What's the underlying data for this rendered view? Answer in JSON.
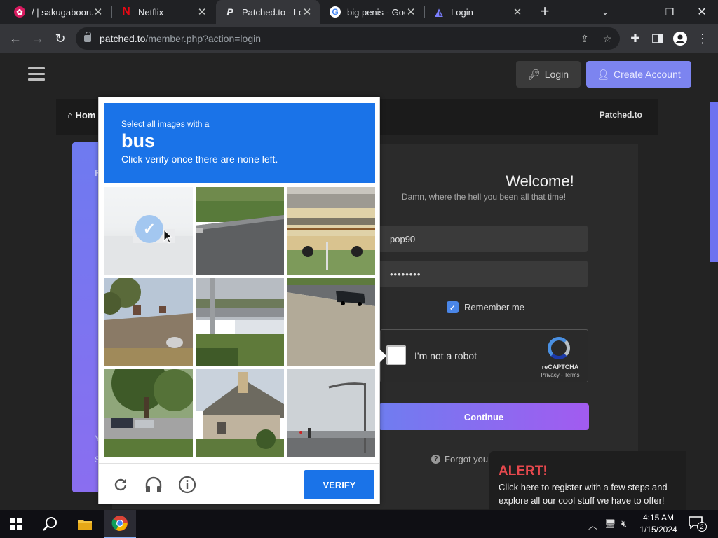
{
  "tabs": [
    {
      "title": "/ | sakugabooru",
      "icon": "sakugabooru-icon"
    },
    {
      "title": "Netflix",
      "icon": "netflix-icon"
    },
    {
      "title": "Patched.to - Log",
      "icon": "patched-icon"
    },
    {
      "title": "big penis - Goo",
      "icon": "google-icon"
    },
    {
      "title": "Login",
      "icon": "login-site-icon"
    }
  ],
  "address": {
    "host": "patched.to",
    "path": "/member.php?action=login"
  },
  "site": {
    "login_label": "Login",
    "create_label": "Create Account",
    "nav_home": "Hom",
    "nav_brand": "Patched.to",
    "left_r": "R",
    "left_y": "Y",
    "left_s": "S",
    "welcome": "Welcome!",
    "subtitle": "Damn, where the hell you been all that time!",
    "username": "pop90",
    "password": "••••••••",
    "remember": "Remember me",
    "recaptcha_label": "I'm not a robot",
    "recaptcha_brand": "reCAPTCHA",
    "recaptcha_terms": "Privacy - Terms",
    "continue": "Continue",
    "forgot": "Forgot your"
  },
  "alert": {
    "title": "ALERT!",
    "body": "Click here to register with a few steps and explore all our cool stuff we have to offer!"
  },
  "captcha": {
    "line1": "Select all images with a",
    "keyword": "bus",
    "line3": "Click verify once there are none left.",
    "verify": "VERIFY",
    "tiles": [
      {
        "name": "tile-1",
        "selected": true
      },
      {
        "name": "tile-2",
        "selected": false
      },
      {
        "name": "tile-3",
        "selected": false
      },
      {
        "name": "tile-4",
        "selected": false
      },
      {
        "name": "tile-5",
        "selected": false
      },
      {
        "name": "tile-6",
        "selected": false
      },
      {
        "name": "tile-7",
        "selected": false
      },
      {
        "name": "tile-8",
        "selected": false
      },
      {
        "name": "tile-9",
        "selected": false
      }
    ]
  },
  "taskbar": {
    "time": "4:15 AM",
    "date": "1/15/2024",
    "notifications": "2"
  },
  "colors": {
    "accent": "#1a73e8",
    "brand": "#7c84f0",
    "alert": "#e5484d"
  }
}
